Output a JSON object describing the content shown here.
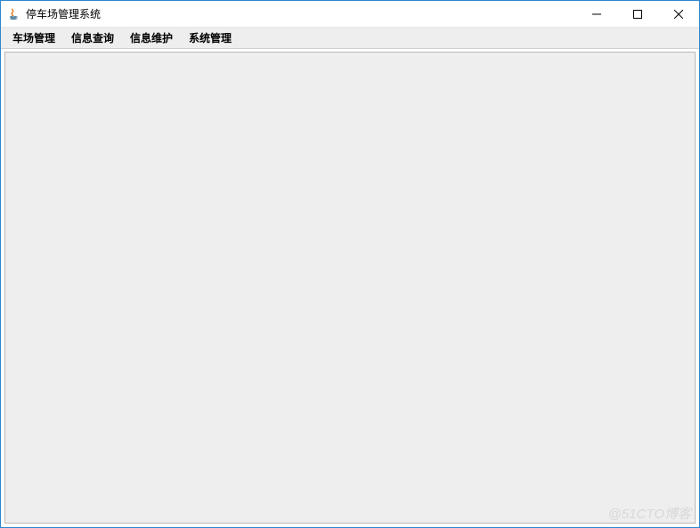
{
  "window": {
    "title": "停车场管理系统"
  },
  "menu": {
    "items": [
      {
        "label": "车场管理"
      },
      {
        "label": "信息查询"
      },
      {
        "label": "信息维护"
      },
      {
        "label": "系统管理"
      }
    ]
  },
  "watermark": "@51CTO博客"
}
